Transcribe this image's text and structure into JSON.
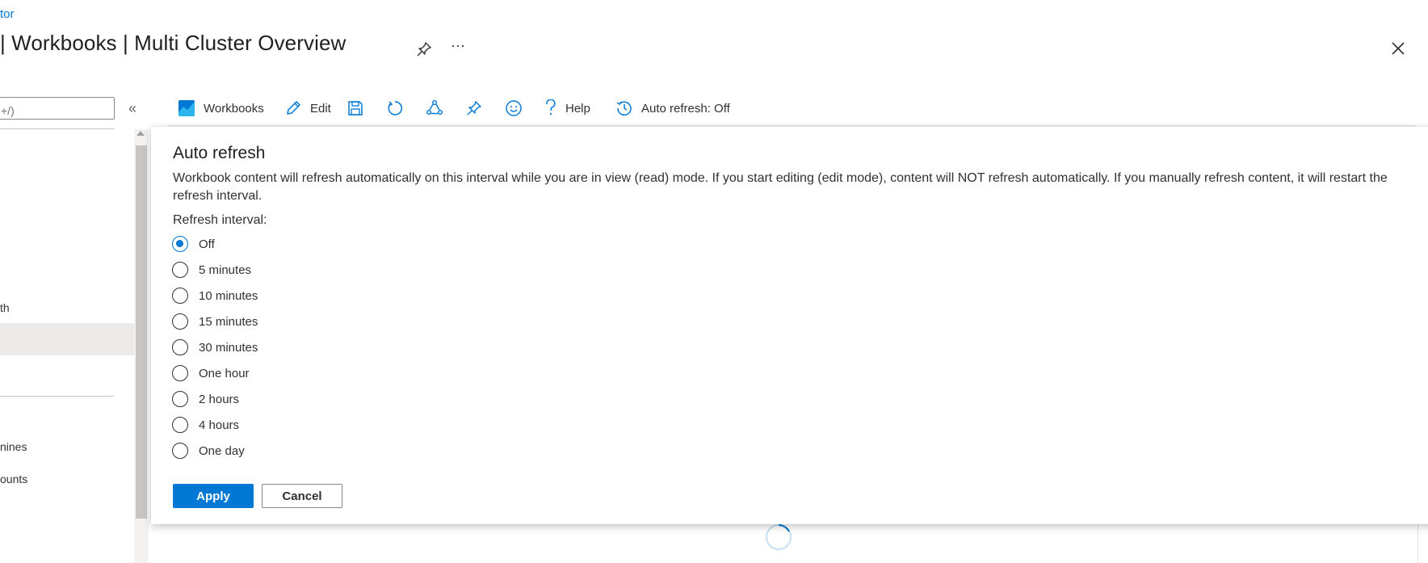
{
  "header": {
    "breadcrumb": "tor",
    "title": "| Workbooks | Multi Cluster Overview",
    "more_glyph": "···",
    "pin_icon": "pin-icon",
    "close_icon": "close-icon"
  },
  "left_nav": {
    "search_placeholder": "+/)",
    "collapse_glyph": "«",
    "items": [
      {
        "label": "th"
      },
      {
        "label": "nines"
      },
      {
        "label": "ounts"
      }
    ]
  },
  "toolbar": {
    "workbooks_label": "Workbooks",
    "edit_label": "Edit",
    "help_label": "Help",
    "auto_refresh_label": "Auto refresh: Off"
  },
  "panel": {
    "title": "Auto refresh",
    "description": "Workbook content will refresh automatically on this interval while you are in view (read) mode. If you start editing (edit mode), content will NOT refresh automatically. If you manually refresh content, it will restart the refresh interval.",
    "field_label": "Refresh interval:",
    "options": [
      {
        "label": "Off",
        "checked": true
      },
      {
        "label": "5 minutes",
        "checked": false
      },
      {
        "label": "10 minutes",
        "checked": false
      },
      {
        "label": "15 minutes",
        "checked": false
      },
      {
        "label": "30 minutes",
        "checked": false
      },
      {
        "label": "One hour",
        "checked": false
      },
      {
        "label": "2 hours",
        "checked": false
      },
      {
        "label": "4 hours",
        "checked": false
      },
      {
        "label": "One day",
        "checked": false
      }
    ],
    "apply_label": "Apply",
    "cancel_label": "Cancel"
  },
  "colors": {
    "accent": "#0078d4",
    "text": "#323130",
    "selected_nav_bg": "#edebe9"
  }
}
